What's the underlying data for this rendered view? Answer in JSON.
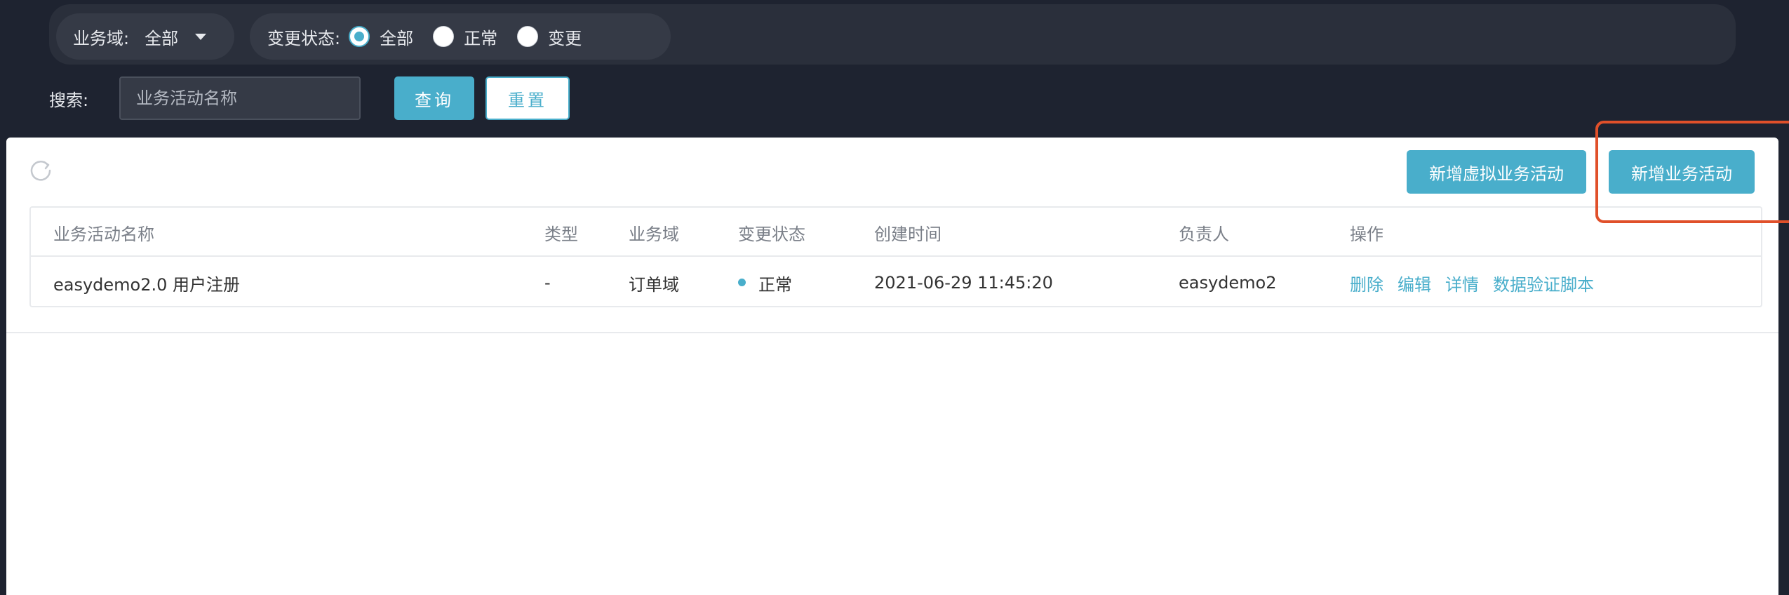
{
  "filters": {
    "domain_label": "业务域:",
    "domain_value": "全部",
    "status_label": "变更状态:",
    "status_options": [
      {
        "label": "全部",
        "checked": true
      },
      {
        "label": "正常",
        "checked": false
      },
      {
        "label": "变更",
        "checked": false
      }
    ]
  },
  "search": {
    "label": "搜索:",
    "placeholder": "业务活动名称",
    "query_button": "查询",
    "reset_button": "重置"
  },
  "toolbar": {
    "refresh_icon": "refresh-icon",
    "new_virtual_button": "新增虚拟业务活动",
    "new_button": "新增业务活动"
  },
  "table": {
    "columns": [
      "业务活动名称",
      "类型",
      "业务域",
      "变更状态",
      "创建时间",
      "负责人",
      "操作"
    ],
    "rows": [
      {
        "name": "easydemo2.0 用户注册",
        "type": "-",
        "domain": "订单域",
        "status": "正常",
        "created": "2021-06-29 11:45:20",
        "owner": "easydemo2",
        "actions": [
          "删除",
          "编辑",
          "详情",
          "数据验证脚本"
        ]
      }
    ]
  },
  "colors": {
    "accent": "#49aecb",
    "highlight": "#e0502a",
    "background": "#1e2330"
  }
}
